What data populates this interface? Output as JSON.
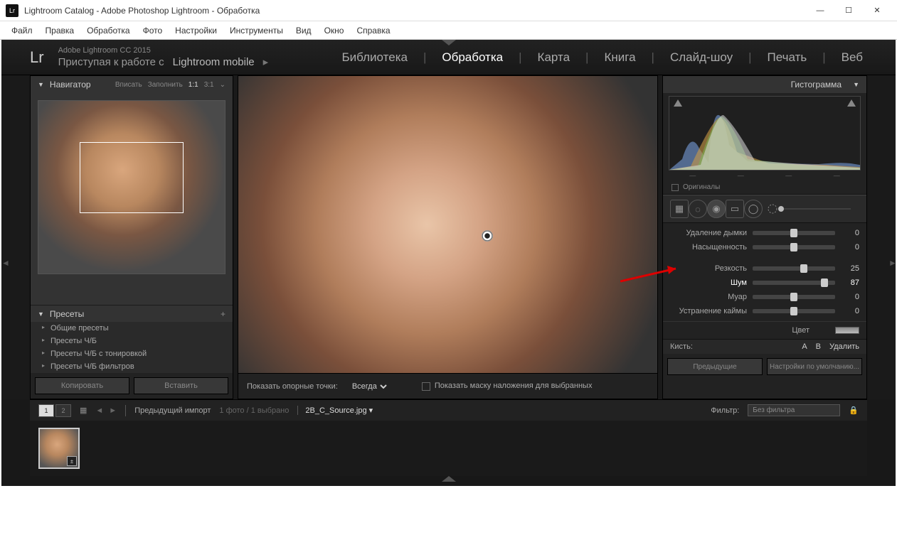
{
  "window": {
    "title": "Lightroom Catalog - Adobe Photoshop Lightroom - Обработка"
  },
  "menu": [
    "Файл",
    "Правка",
    "Обработка",
    "Фото",
    "Настройки",
    "Инструменты",
    "Вид",
    "Окно",
    "Справка"
  ],
  "header": {
    "logo": "Lr",
    "version": "Adobe Lightroom CC 2015",
    "mobile_prefix": "Приступая к работе с",
    "mobile": "Lightroom mobile",
    "tabs": [
      "Библиотека",
      "Обработка",
      "Карта",
      "Книга",
      "Слайд-шоу",
      "Печать",
      "Веб"
    ],
    "active_tab": "Обработка"
  },
  "left": {
    "navigator": {
      "title": "Навигатор",
      "zoom": [
        "Вписать",
        "Заполнить",
        "1:1",
        "3:1"
      ],
      "active_zoom": "1:1"
    },
    "presets": {
      "title": "Пресеты",
      "items": [
        "Общие пресеты",
        "Пресеты Ч/Б",
        "Пресеты Ч/Б с тонировкой",
        "Пресеты Ч/Б фильтров"
      ]
    },
    "footer": {
      "copy": "Копировать",
      "paste": "Вставить"
    }
  },
  "center_footer": {
    "show_pins_label": "Показать опорные точки:",
    "show_pins_value": "Всегда",
    "mask_overlay": "Показать маску наложения для выбранных"
  },
  "right": {
    "histogram_title": "Гистограмма",
    "originals": "Оригиналы",
    "sliders": [
      {
        "label": "Удаление дымки",
        "value": 0,
        "pos": 50
      },
      {
        "label": "Насыщенность",
        "value": 0,
        "pos": 50
      },
      {
        "label": "Резкость",
        "value": 25,
        "pos": 62
      },
      {
        "label": "Шум",
        "value": 87,
        "pos": 87,
        "highlight": true
      },
      {
        "label": "Муар",
        "value": 0,
        "pos": 50
      },
      {
        "label": "Устранение каймы",
        "value": 0,
        "pos": 50
      }
    ],
    "color_label": "Цвет",
    "brush": {
      "label": "Кисть:",
      "a": "A",
      "b": "B",
      "del": "Удалить"
    },
    "footer": {
      "prev": "Предыдущие",
      "defaults": "Настройки по умолчанию..."
    }
  },
  "filmstrip": {
    "prev_import": "Предыдущий импорт",
    "count": "1 фото  /  1 выбрано",
    "filename": "2B_C_Source.jpg",
    "filter_label": "Фильтр:",
    "filter_value": "Без фильтра"
  }
}
